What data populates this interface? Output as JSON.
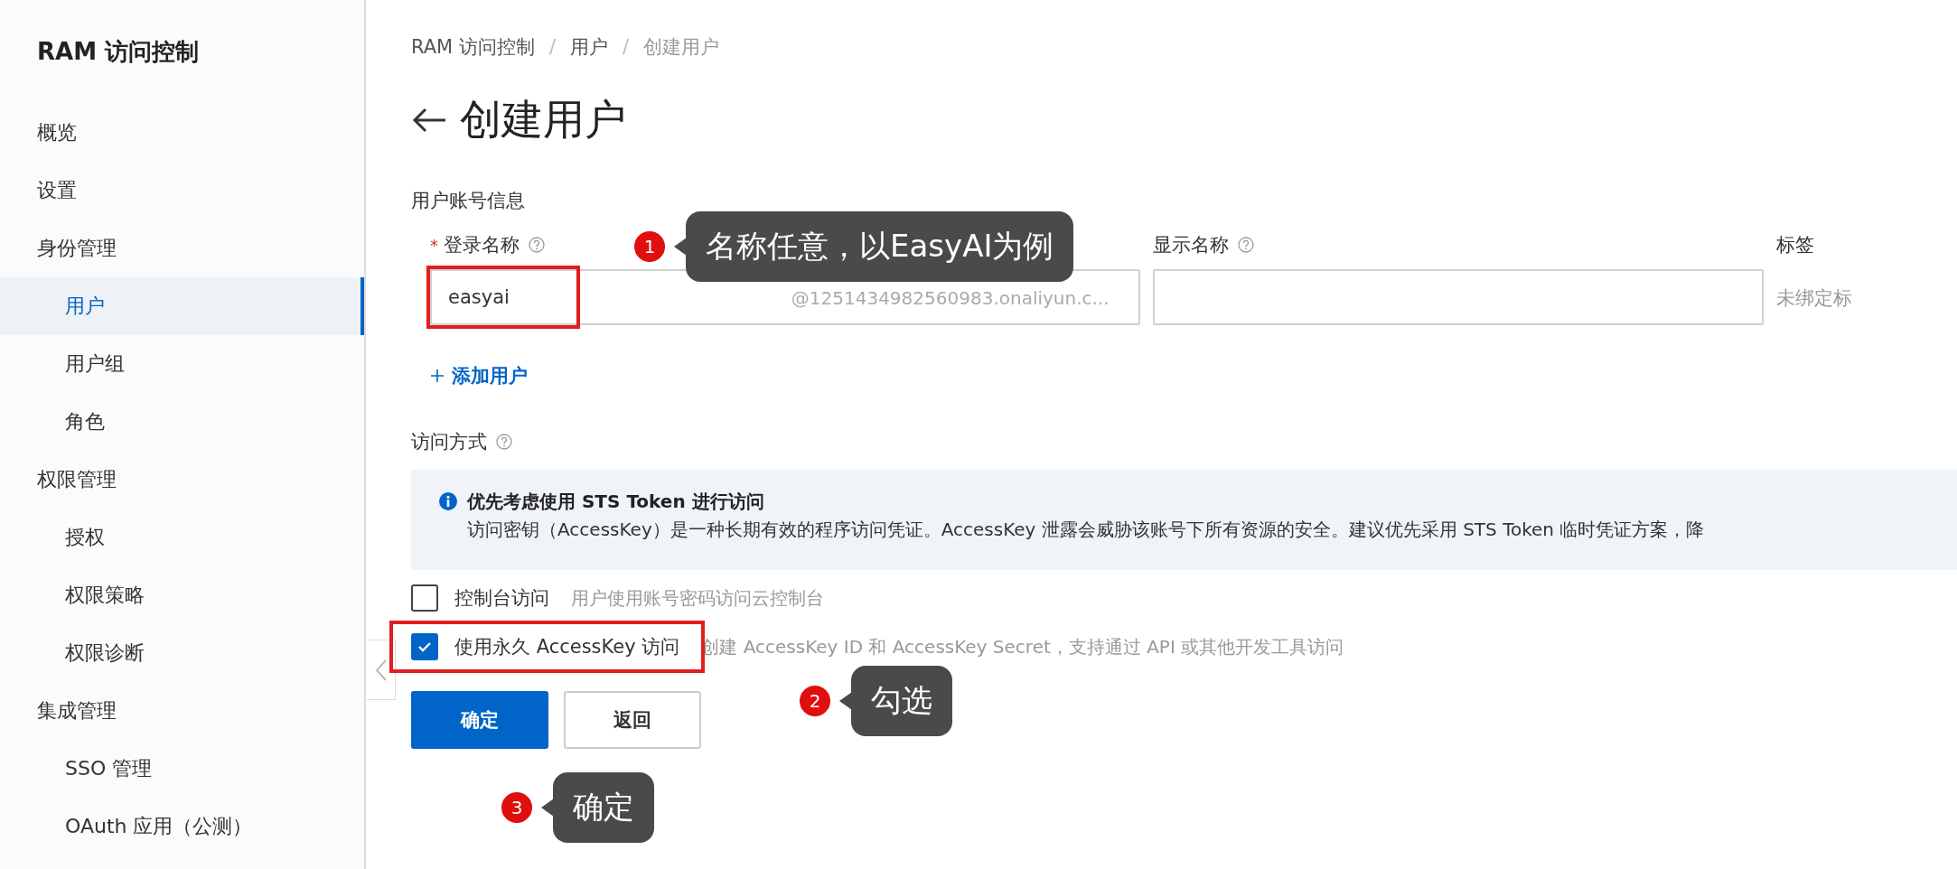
{
  "sidebar": {
    "title": "RAM 访问控制",
    "items": [
      {
        "label": "概览",
        "selected": false
      },
      {
        "label": "设置",
        "selected": false
      },
      {
        "label": "身份管理",
        "selected": false,
        "children": [
          {
            "label": "用户",
            "selected": true
          },
          {
            "label": "用户组",
            "selected": false
          },
          {
            "label": "角色",
            "selected": false
          }
        ]
      },
      {
        "label": "权限管理",
        "selected": false,
        "children": [
          {
            "label": "授权",
            "selected": false
          },
          {
            "label": "权限策略",
            "selected": false
          },
          {
            "label": "权限诊断",
            "selected": false
          }
        ]
      },
      {
        "label": "集成管理",
        "selected": false,
        "children": [
          {
            "label": "SSO 管理",
            "selected": false
          },
          {
            "label": "OAuth 应用（公测）",
            "selected": false
          }
        ]
      }
    ]
  },
  "breadcrumb": [
    {
      "label": "RAM 访问控制",
      "current": false
    },
    {
      "separator": "/",
      "label": "用户",
      "current": false
    },
    {
      "separator": "/",
      "label": "创建用户",
      "current": true
    }
  ],
  "page_title": "创建用户",
  "section_title": "用户账号信息",
  "fields": [
    {
      "required_mark": "*",
      "label": "登录名称",
      "help": true,
      "value": "easyai",
      "suffix": "@1251434982560983.onaliyun.c...",
      "highlighted": true
    },
    {
      "label": "显示名称",
      "help": true,
      "highlighted": false
    }
  ],
  "tags": {
    "label": "标签",
    "value": "未绑定标"
  },
  "add_user": "添加用户",
  "access": {
    "label": "访问方式",
    "help": true,
    "notice": {
      "title": "优先考虑使用 STS Token 进行访问",
      "text": "访问密钥（AccessKey）是一种长期有效的程序访问凭证。AccessKey 泄露会威胁该账号下所有资源的安全。建议优先采用 STS Token 临时凭证方案，降"
    },
    "options": [
      {
        "label": "控制台访问",
        "description": "用户使用账号密码访问云控制台",
        "checked": false,
        "highlighted": false
      },
      {
        "label": "使用永久 AccessKey 访问",
        "description": "创建 AccessKey ID 和 AccessKey Secret，支持通过 API 或其他开发工具访问",
        "checked": true,
        "highlighted": true
      }
    ]
  },
  "buttons": [
    {
      "label": "确定",
      "kind": "primary"
    },
    {
      "label": "返回",
      "kind": "secondary"
    }
  ],
  "annotations": [
    {
      "number": "1",
      "text": "名称任意，以EasyAI为例"
    },
    {
      "number": "2",
      "text": "勾选"
    },
    {
      "number": "3",
      "text": "确定"
    }
  ]
}
